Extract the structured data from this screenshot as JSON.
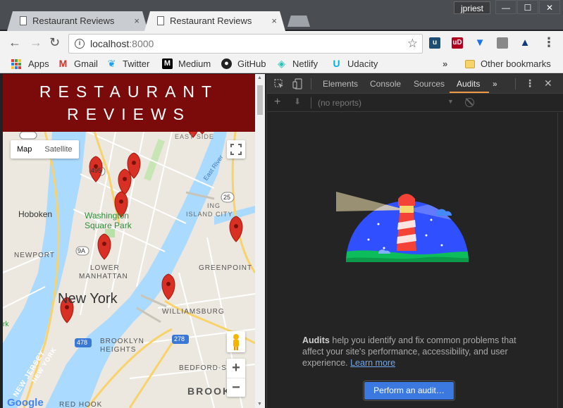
{
  "window": {
    "profile_name": "jpriest",
    "minimize": "—",
    "maximize": "☐",
    "close": "✕"
  },
  "tabs": [
    {
      "title": "Restaurant Reviews",
      "close": "×",
      "active": false
    },
    {
      "title": "Restaurant Reviews",
      "close": "×",
      "active": true
    }
  ],
  "toolbar": {
    "back": "←",
    "forward": "→",
    "reload": "↻",
    "url_host": "localhost",
    "url_port": ":8000",
    "star": "☆",
    "menu": "⋮"
  },
  "extensions": [
    "ublock-icon",
    "vue-devtools-icon",
    "bitwarden-icon",
    "window-icon",
    "alert-icon"
  ],
  "bookmarks": {
    "items": [
      {
        "label": "Apps",
        "icon": "apps-grid-icon"
      },
      {
        "label": "Gmail",
        "icon": "gmail-icon"
      },
      {
        "label": "Twitter",
        "icon": "twitter-icon"
      },
      {
        "label": "Medium",
        "icon": "medium-icon"
      },
      {
        "label": "GitHub",
        "icon": "github-icon"
      },
      {
        "label": "Netlify",
        "icon": "netlify-icon"
      },
      {
        "label": "Udacity",
        "icon": "udacity-icon"
      }
    ],
    "overflow": "»",
    "other": "Other bookmarks"
  },
  "page": {
    "title_line1": "RESTAURANT",
    "title_line2": "REVIEWS",
    "header_color": "#7b0a0a"
  },
  "map": {
    "type_map": "Map",
    "type_satellite": "Satellite",
    "zoom_in": "+",
    "zoom_out": "−",
    "labels": {
      "hoboken": "Hoboken",
      "washington_sq1": "Washington",
      "washington_sq2": "Square Park",
      "newport": "NEWPORT",
      "lower1": "LOWER",
      "lower2": "MANHATTAN",
      "new_york": "New York",
      "greenpoint": "GREENPOINT",
      "williamsburg": "WILLIAMSBURG",
      "brooklyn1": "BROOKLYN",
      "brooklyn2": "HEIGHTS",
      "bedford": "BEDFORD-ST",
      "brook": "BROOK",
      "east_side": "EAST SIDE",
      "east_river": "East River",
      "island_city1": "ING",
      "island_city2": "ISLAND CITY",
      "new_jersey": "NEW JERSEY",
      "new_york_side": "NEW YORK",
      "red_hook": "RED HOOK",
      "google": "Google",
      "ark": "rk",
      "shield_495": "495",
      "shield_25": "25",
      "shield_9a": "9A",
      "shield_278": "278",
      "shield_478": "478"
    },
    "marker_color": "#d93025"
  },
  "devtools": {
    "tabs": [
      "Elements",
      "Console",
      "Sources",
      "Audits"
    ],
    "active_tab": "Audits",
    "more": "»",
    "menu": "⋮",
    "close": "✕",
    "reports_placeholder": "(no reports)",
    "audit_title": "Audits",
    "audit_text": " help you identify and fix common problems that affect your site's performance, accessibility, and user experience. ",
    "learn_more": "Learn more",
    "button": "Perform an audit…",
    "accent": "#ed9a43",
    "button_color": "#3b78e0"
  }
}
